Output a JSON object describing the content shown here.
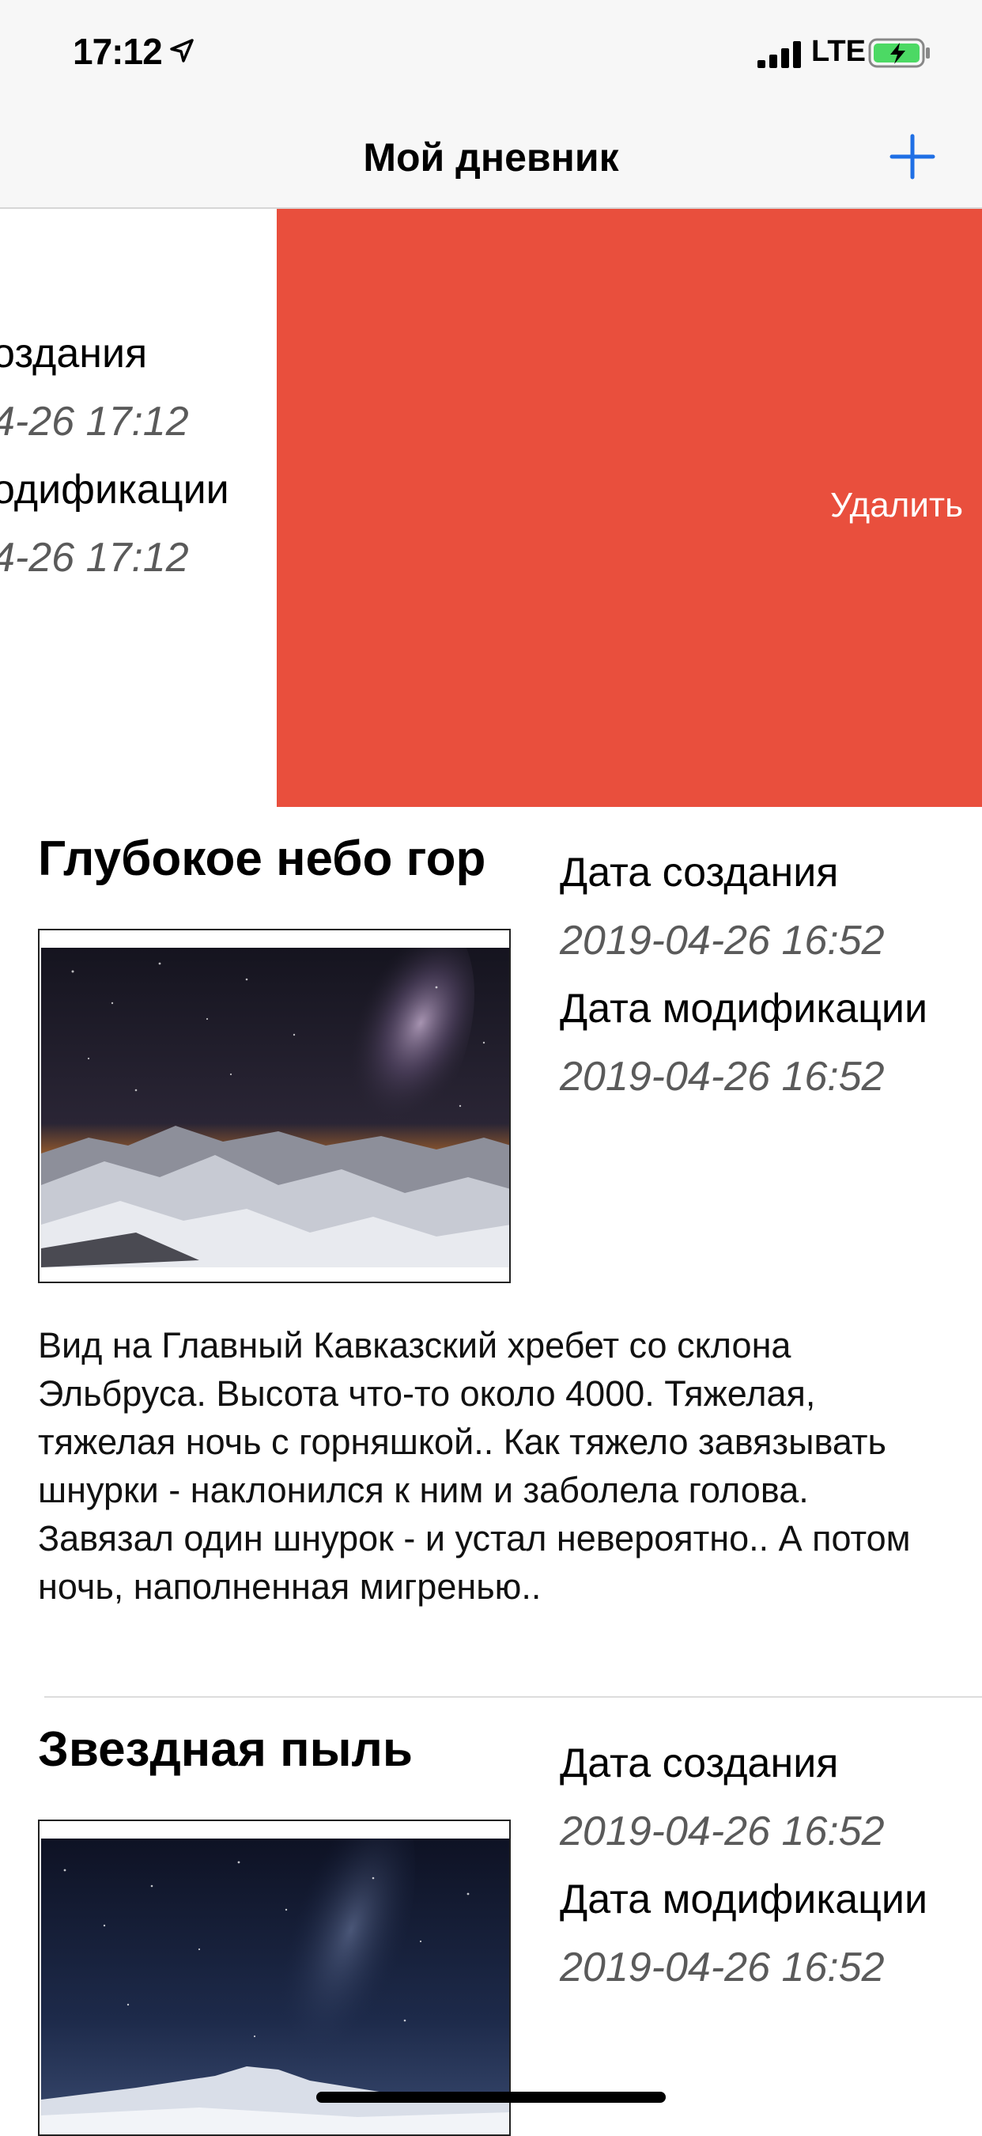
{
  "status_bar": {
    "time": "17:12",
    "network": "LTE",
    "icons": [
      "location-arrow-icon",
      "signal-bars-icon",
      "battery-charging-icon"
    ]
  },
  "nav": {
    "title": "Мой дневник",
    "add_icon": "plus-icon",
    "accent_color": "#1f6fe5"
  },
  "swiped_entry": {
    "created_label": "оздания",
    "created_value": "4-26 17:12",
    "modified_label": "одификации",
    "modified_value": "4-26 17:12",
    "delete_label": "Удалить",
    "delete_color": "#e94f3d"
  },
  "entries": [
    {
      "title": "Глубокое небо гор",
      "created_label": "Дата создания",
      "created_value": "2019-04-26 16:52",
      "modified_label": "Дата модификации",
      "modified_value": "2019-04-26 16:52",
      "text": "Вид на Главный Кавказский хребет со склона Эльбруса. Высота что-то около 4000. Тяжелая, тяжелая ночь с горняшкой.. Как тяжело завязывать шнурки - наклонился к ним и заболела голова. Завязал один шнурок - и устал невероятно.. А потом ночь, наполненная мигренью.."
    },
    {
      "title": "Звездная пыль",
      "created_label": "Дата создания",
      "created_value": "2019-04-26 16:52",
      "modified_label": "Дата модификации",
      "modified_value": "2019-04-26 16:52"
    }
  ]
}
